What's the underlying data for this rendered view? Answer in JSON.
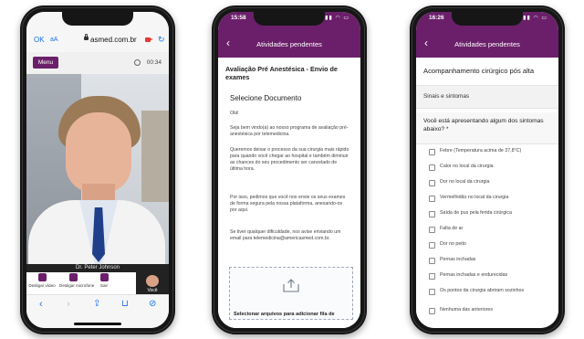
{
  "call": {
    "ok": "OK",
    "text_size": "aA",
    "url": "asmed.com.br",
    "menu": "Menu",
    "timer": "00:34",
    "doctor": "Dr. Peter Johnson",
    "controls": [
      "Desligar vídeo",
      "Desligar microfone",
      "Sair"
    ],
    "self": "Você"
  },
  "docs": {
    "status_time": "15:58",
    "nav_title": "Atividades pendentes",
    "heading": "Avaliação Pré Anestésica - Envio de exames",
    "subheading": "Selecione Documento",
    "greeting": "Olá!",
    "p1": "Seja bem vindo(a) ao nosso programa de avaliação pré-anestésica por telemedicina.",
    "p2": "Queremos deixar o processo da sua cirurgia mais rápido para quando você chegar ao hospital e também diminuir as chances do seu procedimento ser cancelado de última hora.",
    "p3": "Por isso, pedimos que você nos envie os seus exames de forma segura pela nossa plataforma, anexando-os por aqui.",
    "p4": "Se tiver qualquer dificuldade, nos avise enviando um email para telemedicina@americasmed.com.br.",
    "upload": "Selecionar arquivos para adicionar fila de"
  },
  "followup": {
    "status_time": "16:26",
    "nav_title": "Atividades pendentes",
    "title": "Acompanhamento cirúrgico pós alta",
    "section": "Sinais e sintomas",
    "question": "Você está apresentando algum dos sintomas abaixo? *",
    "options": [
      "Febre (Temperatura acima de 37,8°C)",
      "Calor no local da cirurgia",
      "Dor no local da cirurgia",
      "Vermelhidão no local da cirurgia",
      "Saída de pus pela ferida cirúrgica",
      "Falta de ar",
      "Dor no peito",
      "Pernas inchadas",
      "Pernas inchadas e endurecidas",
      "Os pontos da cirurgia abriram sozinhos",
      "Nenhuma das anteriores"
    ]
  }
}
